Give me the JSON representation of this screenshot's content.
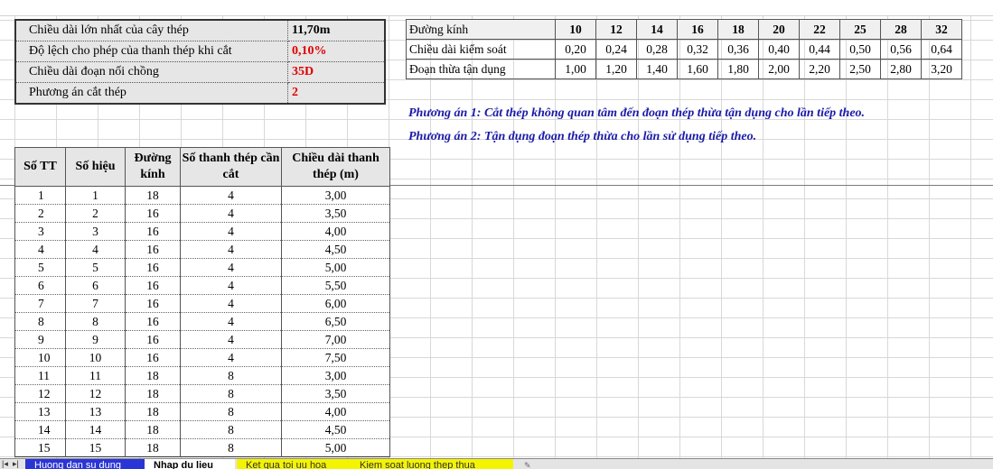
{
  "params": [
    {
      "label": "Chiều dài lớn nhất của cây thép",
      "value": "11,70m",
      "red": false
    },
    {
      "label": "Độ lệch cho phép của thanh thép khi cắt",
      "value": "0,10%",
      "red": true
    },
    {
      "label": "Chiều dài đoạn nối chồng",
      "value": "35D",
      "red": true
    },
    {
      "label": "Phương án cắt thép",
      "value": "2",
      "red": true
    }
  ],
  "diameter_table": {
    "row_labels": [
      "Đường kính",
      "Chiều dài kiểm soát",
      "Đoạn thừa tận dụng"
    ],
    "diameters": [
      "10",
      "12",
      "14",
      "16",
      "18",
      "20",
      "22",
      "25",
      "28",
      "32"
    ],
    "control_length": [
      "0,20",
      "0,24",
      "0,28",
      "0,32",
      "0,36",
      "0,40",
      "0,44",
      "0,50",
      "0,56",
      "0,64"
    ],
    "reuse_length": [
      "1,00",
      "1,20",
      "1,40",
      "1,60",
      "1,80",
      "2,00",
      "2,20",
      "2,50",
      "2,80",
      "3,20"
    ]
  },
  "notes": [
    "Phương án 1: Cắt thép không quan tâm đến đoạn thép thừa tận dụng cho lần tiếp theo.",
    "Phương án 2: Tận dụng đoạn thép thừa cho lần sử dụng tiếp theo."
  ],
  "data_table": {
    "headers": [
      "Số TT",
      "Số hiệu",
      "Đường kính",
      "Số thanh thép cần cắt",
      "Chiều dài thanh thép (m)"
    ],
    "rows": [
      [
        "1",
        "1",
        "18",
        "4",
        "3,00"
      ],
      [
        "2",
        "2",
        "16",
        "4",
        "3,50"
      ],
      [
        "3",
        "3",
        "16",
        "4",
        "4,00"
      ],
      [
        "4",
        "4",
        "16",
        "4",
        "4,50"
      ],
      [
        "5",
        "5",
        "16",
        "4",
        "5,00"
      ],
      [
        "6",
        "6",
        "16",
        "4",
        "5,50"
      ],
      [
        "7",
        "7",
        "16",
        "4",
        "6,00"
      ],
      [
        "8",
        "8",
        "16",
        "4",
        "6,50"
      ],
      [
        "9",
        "9",
        "16",
        "4",
        "7,00"
      ],
      [
        "10",
        "10",
        "16",
        "4",
        "7,50"
      ],
      [
        "11",
        "11",
        "18",
        "8",
        "3,00"
      ],
      [
        "12",
        "12",
        "18",
        "8",
        "3,50"
      ],
      [
        "13",
        "13",
        "18",
        "8",
        "4,00"
      ],
      [
        "14",
        "14",
        "18",
        "8",
        "4,50"
      ],
      [
        "15",
        "15",
        "18",
        "8",
        "5,00"
      ]
    ]
  },
  "tabs": [
    {
      "label": "Huong dan su dung",
      "style": "blue"
    },
    {
      "label": "Nhap du lieu",
      "style": "active"
    },
    {
      "label": "Ket qua toi uu hoa",
      "style": "yellow1"
    },
    {
      "label": "Kiem soat luong thep thua",
      "style": "yellow2"
    }
  ]
}
